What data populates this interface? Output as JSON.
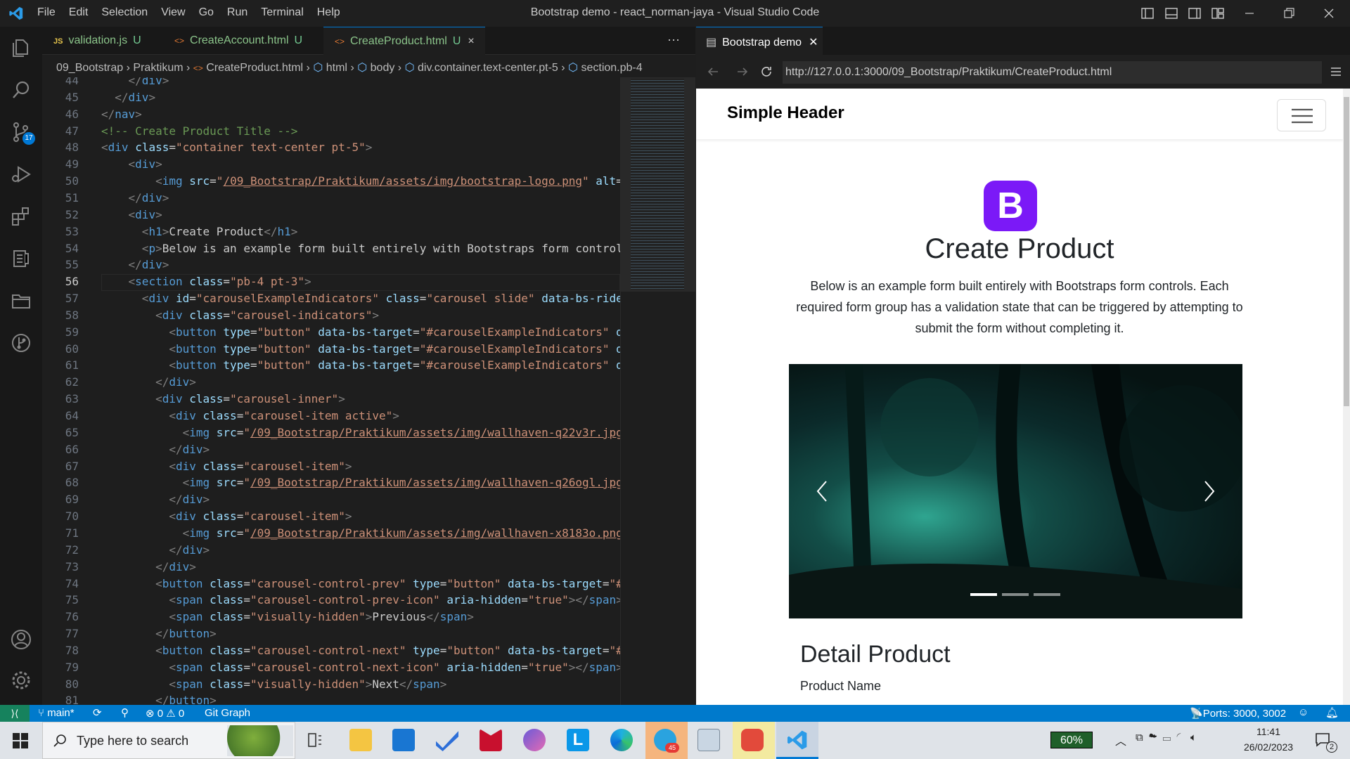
{
  "window": {
    "title": "Bootstrap demo - react_norman-jaya - Visual Studio Code",
    "menu": [
      "File",
      "Edit",
      "Selection",
      "View",
      "Go",
      "Run",
      "Terminal",
      "Help"
    ]
  },
  "activity_bar": {
    "source_control_badge": "17"
  },
  "editor_tabs": [
    {
      "label": "validation.js",
      "status": "U",
      "icon": "JS"
    },
    {
      "label": "CreateAccount.html",
      "status": "U",
      "icon": "<>"
    },
    {
      "label": "CreateProduct.html",
      "status": "U",
      "icon": "<>"
    }
  ],
  "breadcrumb": [
    "09_Bootstrap",
    "Praktikum",
    "CreateProduct.html",
    "html",
    "body",
    "div.container.text-center.pt-5",
    "section.pb-4"
  ],
  "code_lines": [
    {
      "n": "44",
      "html": "    <span class='t'>&lt;/</span><span class='n'>div</span><span class='t'>&gt;</span>"
    },
    {
      "n": "45",
      "html": "  <span class='t'>&lt;/</span><span class='n'>div</span><span class='t'>&gt;</span>"
    },
    {
      "n": "46",
      "html": "<span class='t'>&lt;/</span><span class='n'>nav</span><span class='t'>&gt;</span>"
    },
    {
      "n": "47",
      "html": "<span class='c'>&lt;!-- Create Product Title --&gt;</span>"
    },
    {
      "n": "48",
      "html": "<span class='t'>&lt;</span><span class='n'>div</span> <span class='a'>class</span>=<span class='s'>\"container text-center pt-5\"</span><span class='t'>&gt;</span>"
    },
    {
      "n": "49",
      "html": "    <span class='t'>&lt;</span><span class='n'>div</span><span class='t'>&gt;</span>"
    },
    {
      "n": "50",
      "html": "        <span class='t'>&lt;</span><span class='n'>img</span> <span class='a'>src</span>=<span class='s'>\"<span class='u'>/09_Bootstrap/Praktikum/assets/img/bootstrap-logo.png</span>\"</span> <span class='a'>alt</span>="
    },
    {
      "n": "51",
      "html": "    <span class='t'>&lt;/</span><span class='n'>div</span><span class='t'>&gt;</span>"
    },
    {
      "n": "52",
      "html": "    <span class='t'>&lt;</span><span class='n'>div</span><span class='t'>&gt;</span>"
    },
    {
      "n": "53",
      "html": "      <span class='t'>&lt;</span><span class='n'>h1</span><span class='t'>&gt;</span>Create Product<span class='t'>&lt;/</span><span class='n'>h1</span><span class='t'>&gt;</span>"
    },
    {
      "n": "54",
      "html": "      <span class='t'>&lt;</span><span class='n'>p</span><span class='t'>&gt;</span>Below is an example form built entirely with Bootstraps form control"
    },
    {
      "n": "55",
      "html": "    <span class='t'>&lt;/</span><span class='n'>div</span><span class='t'>&gt;</span>"
    },
    {
      "n": "56",
      "html": "    <span class='t'>&lt;</span><span class='n'>section</span> <span class='a'>class</span>=<span class='s'>\"pb-4 pt-3\"</span><span class='t'>&gt;</span>"
    },
    {
      "n": "57",
      "html": "      <span class='t'>&lt;</span><span class='n'>div</span> <span class='a'>id</span>=<span class='s'>\"carouselExampleIndicators\"</span> <span class='a'>class</span>=<span class='s'>\"carousel slide\"</span> <span class='a'>data-bs-ride</span>"
    },
    {
      "n": "58",
      "html": "        <span class='t'>&lt;</span><span class='n'>div</span> <span class='a'>class</span>=<span class='s'>\"carousel-indicators\"</span><span class='t'>&gt;</span>"
    },
    {
      "n": "59",
      "html": "          <span class='t'>&lt;</span><span class='n'>button</span> <span class='a'>type</span>=<span class='s'>\"button\"</span> <span class='a'>data-bs-target</span>=<span class='s'>\"#carouselExampleIndicators\"</span> <span class='a'>d</span>"
    },
    {
      "n": "60",
      "html": "          <span class='t'>&lt;</span><span class='n'>button</span> <span class='a'>type</span>=<span class='s'>\"button\"</span> <span class='a'>data-bs-target</span>=<span class='s'>\"#carouselExampleIndicators\"</span> <span class='a'>d</span>"
    },
    {
      "n": "61",
      "html": "          <span class='t'>&lt;</span><span class='n'>button</span> <span class='a'>type</span>=<span class='s'>\"button\"</span> <span class='a'>data-bs-target</span>=<span class='s'>\"#carouselExampleIndicators\"</span> <span class='a'>d</span>"
    },
    {
      "n": "62",
      "html": "        <span class='t'>&lt;/</span><span class='n'>div</span><span class='t'>&gt;</span>"
    },
    {
      "n": "63",
      "html": "        <span class='t'>&lt;</span><span class='n'>div</span> <span class='a'>class</span>=<span class='s'>\"carousel-inner\"</span><span class='t'>&gt;</span>"
    },
    {
      "n": "64",
      "html": "          <span class='t'>&lt;</span><span class='n'>div</span> <span class='a'>class</span>=<span class='s'>\"carousel-item active\"</span><span class='t'>&gt;</span>"
    },
    {
      "n": "65",
      "html": "            <span class='t'>&lt;</span><span class='n'>img</span> <span class='a'>src</span>=<span class='s'>\"<span class='u'>/09_Bootstrap/Praktikum/assets/img/wallhaven-q22v3r.jpg</span></span>"
    },
    {
      "n": "66",
      "html": "          <span class='t'>&lt;/</span><span class='n'>div</span><span class='t'>&gt;</span>"
    },
    {
      "n": "67",
      "html": "          <span class='t'>&lt;</span><span class='n'>div</span> <span class='a'>class</span>=<span class='s'>\"carousel-item\"</span><span class='t'>&gt;</span>"
    },
    {
      "n": "68",
      "html": "            <span class='t'>&lt;</span><span class='n'>img</span> <span class='a'>src</span>=<span class='s'>\"<span class='u'>/09_Bootstrap/Praktikum/assets/img/wallhaven-q26ogl.jpg</span></span>"
    },
    {
      "n": "69",
      "html": "          <span class='t'>&lt;/</span><span class='n'>div</span><span class='t'>&gt;</span>"
    },
    {
      "n": "70",
      "html": "          <span class='t'>&lt;</span><span class='n'>div</span> <span class='a'>class</span>=<span class='s'>\"carousel-item\"</span><span class='t'>&gt;</span>"
    },
    {
      "n": "71",
      "html": "            <span class='t'>&lt;</span><span class='n'>img</span> <span class='a'>src</span>=<span class='s'>\"<span class='u'>/09_Bootstrap/Praktikum/assets/img/wallhaven-x8183o.png</span></span>"
    },
    {
      "n": "72",
      "html": "          <span class='t'>&lt;/</span><span class='n'>div</span><span class='t'>&gt;</span>"
    },
    {
      "n": "73",
      "html": "        <span class='t'>&lt;/</span><span class='n'>div</span><span class='t'>&gt;</span>"
    },
    {
      "n": "74",
      "html": "        <span class='t'>&lt;</span><span class='n'>button</span> <span class='a'>class</span>=<span class='s'>\"carousel-control-prev\"</span> <span class='a'>type</span>=<span class='s'>\"button\"</span> <span class='a'>data-bs-target</span>=<span class='s'>\"#</span>"
    },
    {
      "n": "75",
      "html": "          <span class='t'>&lt;</span><span class='n'>span</span> <span class='a'>class</span>=<span class='s'>\"carousel-control-prev-icon\"</span> <span class='a'>aria-hidden</span>=<span class='s'>\"true\"</span><span class='t'>&gt;&lt;/</span><span class='n'>span</span><span class='t'>&gt;</span>"
    },
    {
      "n": "76",
      "html": "          <span class='t'>&lt;</span><span class='n'>span</span> <span class='a'>class</span>=<span class='s'>\"visually-hidden\"</span><span class='t'>&gt;</span>Previous<span class='t'>&lt;/</span><span class='n'>span</span><span class='t'>&gt;</span>"
    },
    {
      "n": "77",
      "html": "        <span class='t'>&lt;/</span><span class='n'>button</span><span class='t'>&gt;</span>"
    },
    {
      "n": "78",
      "html": "        <span class='t'>&lt;</span><span class='n'>button</span> <span class='a'>class</span>=<span class='s'>\"carousel-control-next\"</span> <span class='a'>type</span>=<span class='s'>\"button\"</span> <span class='a'>data-bs-target</span>=<span class='s'>\"#</span>"
    },
    {
      "n": "79",
      "html": "          <span class='t'>&lt;</span><span class='n'>span</span> <span class='a'>class</span>=<span class='s'>\"carousel-control-next-icon\"</span> <span class='a'>aria-hidden</span>=<span class='s'>\"true\"</span><span class='t'>&gt;&lt;/</span><span class='n'>span</span><span class='t'>&gt;</span>"
    },
    {
      "n": "80",
      "html": "          <span class='t'>&lt;</span><span class='n'>span</span> <span class='a'>class</span>=<span class='s'>\"visually-hidden\"</span><span class='t'>&gt;</span>Next<span class='t'>&lt;/</span><span class='n'>span</span><span class='t'>&gt;</span>"
    },
    {
      "n": "81",
      "html": "        <span class='t'>&lt;/</span><span class='n'>button</span><span class='t'>&gt;</span>"
    }
  ],
  "browser": {
    "tab_label": "Bootstrap demo",
    "url": "http://127.0.0.1:3000/09_Bootstrap/Praktikum/CreateProduct.html"
  },
  "page": {
    "navbar_brand": "Simple Header",
    "logo_letter": "B",
    "heading": "Create Product",
    "lead": "Below is an example form built entirely with Bootstraps form controls. Each required form group has a validation state that can be triggered by attempting to submit the form without completing it.",
    "section_title": "Detail Product",
    "field_label": "Product Name"
  },
  "status_bar": {
    "branch": "main*",
    "problems_errors": "0",
    "problems_warnings": "0",
    "git_graph": "Git Graph",
    "ports": "Ports: 3000, 3002"
  },
  "taskbar": {
    "search_placeholder": "Type here to search",
    "battery": "60%",
    "time": "11:41",
    "date": "26/02/2023",
    "notif_count": "2",
    "telegram_badge": "45"
  },
  "colors": {
    "accent": "#007acc",
    "bootstrap_purple": "#7b19f7"
  }
}
